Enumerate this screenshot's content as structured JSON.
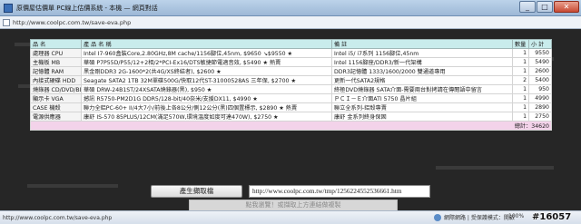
{
  "window": {
    "title": "原價屋估價單 PC線上估價系統 - 本機 — 網頁對話",
    "url": "http://www.coolpc.com.tw/save-eva.php"
  },
  "table": {
    "headers": [
      "品 名",
      "產 品 名 稱",
      "備 註",
      "數量",
      "小 計"
    ],
    "rows": [
      {
        "cat": "處理器 CPU",
        "name": "Intel I7-960盒裝Core,2.80GHz,8M cache/1156腳位,45nm, $9650 ↘$9550 ★",
        "note": "Intel i5/ i7系列 1156腳位,45nm",
        "qty": "1",
        "sub": "9550"
      },
      {
        "cat": "主機板 MB",
        "name": "華碩 P7P55D/P55/12+2相/2*PCI-Ex16/DTS敏捷節電適音效, $5490 ★ 熱賣",
        "note": "Intel 1156腳座/DDR3/新一代架構",
        "qty": "1",
        "sub": "5490"
      },
      {
        "cat": "記憶體 RAM",
        "name": "黑金剛DDR3 2G-1600*2(共4G/XS終結者), $2600 ★",
        "note": "DDR3記憶體 1333/1600/2000 雙通道專用",
        "qty": "1",
        "sub": "2600"
      },
      {
        "cat": "內接式硬碟 HDD",
        "name": "Seagate SATA2 1TB 32M單碟500G/快取12代ST-31000528AS 三年保, $2700 ★",
        "note": "更新一代SATA2規格",
        "qty": "2",
        "sub": "5400"
      },
      {
        "cat": "燒錄器 CD/DVD/BD",
        "name": "華碩 DRW-24B1ST/24XSATA燒錄器(黑), $950 ★",
        "note": "終極DVD燒錄器 SATA介面-需要兩台對拷請在傳閱語中留言",
        "qty": "1",
        "sub": "950"
      },
      {
        "cat": "顯示卡 VGA",
        "name": "撼訊 R5750-PM2D1G DDR5/128-bit/40奈米/支援DX11, $4990 ★",
        "note": "ＰＣＩ－Ｅ介面ATI 5750 晶片組",
        "qty": "1",
        "sub": "4990"
      },
      {
        "cat": "CASE 機殼",
        "name": "聯力全鋁PC-60+ II/4大7小/前後上各8公分/側12公分(黑)四個置標示, $2890 ★ 熱賣",
        "note": "聯立全系列-鋁殼專賣",
        "qty": "1",
        "sub": "2890"
      },
      {
        "cat": "電源供應器",
        "name": "康舒 IS-570 85PLUS/12CM(滿足570W,環境溫度如度可達470W), $2750 ★",
        "note": "康舒 金系列終身保固",
        "qty": "1",
        "sub": "2750"
      }
    ],
    "total": "總計：34620"
  },
  "controls": {
    "generate_label": "產生擷取檔",
    "url_value": "http://www.coolpc.com.tw/tmp/1256224552536661.htm",
    "hint_label": "點我瀏覽！或擷取上方連結做複製"
  },
  "status": {
    "url": "http://www.coolpc.com.tw/save-eva.php",
    "zone": "網際網路 | 受保護模式：開啟",
    "zoom": "100%",
    "badge": "#16057"
  }
}
